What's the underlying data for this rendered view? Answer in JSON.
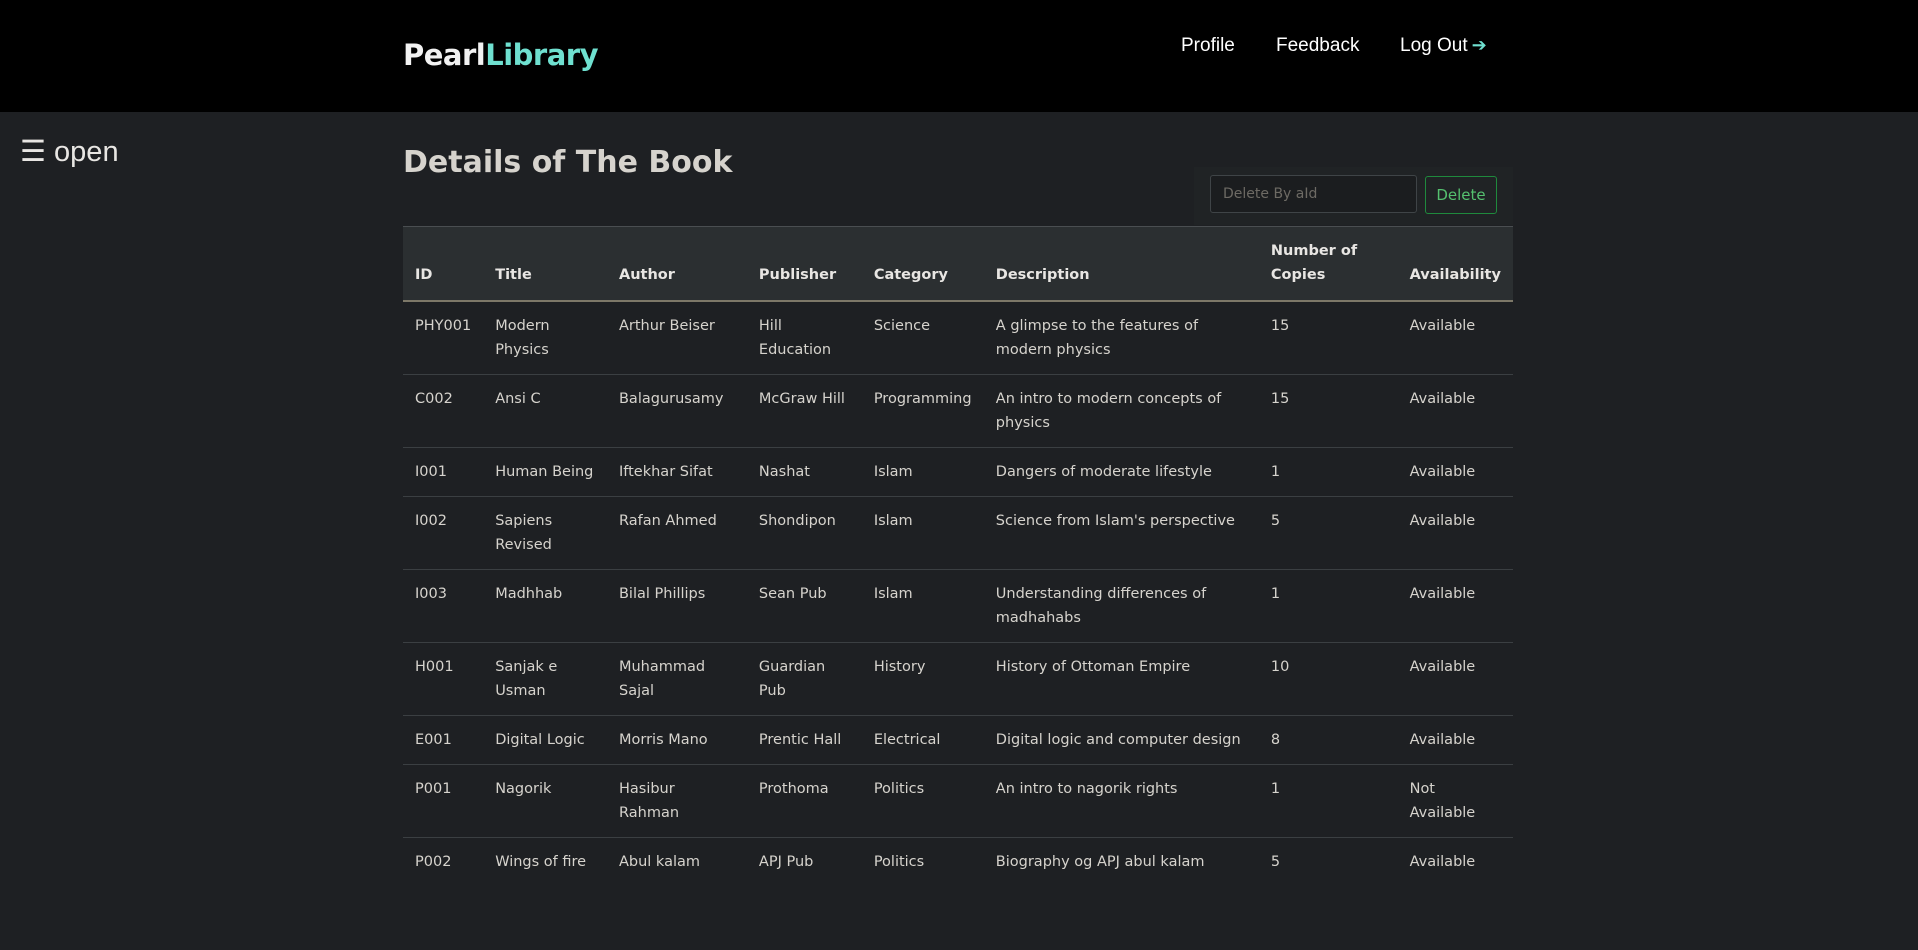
{
  "brand": {
    "part1": "Pearl",
    "part2": "Library"
  },
  "nav": {
    "profile": "Profile",
    "feedback": "Feedback",
    "logout": "Log Out",
    "logout_icon": "➔"
  },
  "sidebar_toggle": "☰ open",
  "page_title": "Details of The Book",
  "delete_form": {
    "placeholder": "Delete By aId",
    "button": "Delete"
  },
  "table": {
    "headers": [
      "ID",
      "Title",
      "Author",
      "Publisher",
      "Category",
      "Description",
      "Number of Copies",
      "Availability"
    ],
    "rows": [
      [
        "PHY001",
        "Modern Physics",
        "Arthur Beiser",
        "Hill Education",
        "Science",
        "A glimpse to the features of modern physics",
        "15",
        "Available"
      ],
      [
        "C002",
        "Ansi C",
        "Balagurusamy",
        "McGraw Hill",
        "Programming",
        "An intro to modern concepts of physics",
        "15",
        "Available"
      ],
      [
        "I001",
        "Human Being",
        "Iftekhar Sifat",
        "Nashat",
        "Islam",
        "Dangers of moderate lifestyle",
        "1",
        "Available"
      ],
      [
        "I002",
        "Sapiens Revised",
        "Rafan Ahmed",
        "Shondipon",
        "Islam",
        "Science from Islam's perspective",
        "5",
        "Available"
      ],
      [
        "I003",
        "Madhhab",
        "Bilal Phillips",
        "Sean Pub",
        "Islam",
        "Understanding differences of madhahabs",
        "1",
        "Available"
      ],
      [
        "H001",
        "Sanjak e Usman",
        "Muhammad Sajal",
        "Guardian Pub",
        "History",
        "History of Ottoman Empire",
        "10",
        "Available"
      ],
      [
        "E001",
        "Digital Logic",
        "Morris Mano",
        "Prentic Hall",
        "Electrical",
        "Digital logic and computer design",
        "8",
        "Available"
      ],
      [
        "P001",
        "Nagorik",
        "Hasibur Rahman",
        "Prothoma",
        "Politics",
        "An intro to nagorik rights",
        "1",
        "Not Available"
      ],
      [
        "P002",
        "Wings of fire",
        "Abul kalam",
        "APJ Pub",
        "Politics",
        "Biography og APJ abul kalam",
        "5",
        "Available"
      ]
    ]
  }
}
